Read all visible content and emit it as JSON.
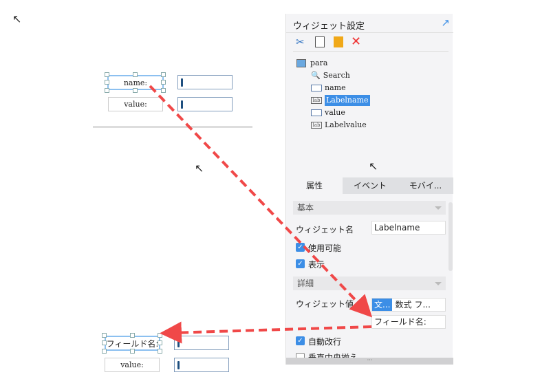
{
  "canvas_top": {
    "labels": [
      "name:",
      "value:"
    ]
  },
  "canvas_bottom": {
    "labels": [
      "フィールド名:",
      "value:"
    ]
  },
  "panel": {
    "title": "ウィジェット設定",
    "toolbar": [
      "cut-icon",
      "copy-icon",
      "paste-icon",
      "delete-icon"
    ],
    "tree": {
      "root": "para",
      "items": [
        "Search",
        "name",
        "Labelname",
        "value",
        "Labelvalue"
      ],
      "selected": "Labelname"
    },
    "tabs": [
      "属性",
      "イベント",
      "モバイ..."
    ],
    "sections": {
      "basic": "基本",
      "detail": "詳細"
    },
    "widget_name_label": "ウィジェット名",
    "widget_name_value": "Labelname",
    "enabled_label": "使用可能",
    "visible_label": "表示",
    "widget_value_label": "ウィジェット値",
    "value_types": [
      "文...",
      "数式",
      "フ..."
    ],
    "widget_value": "フィールド名:",
    "autowrap_label": "自動改行",
    "vertical_center_label": "垂直中央揃え",
    "accent": "#3c8ee6"
  }
}
